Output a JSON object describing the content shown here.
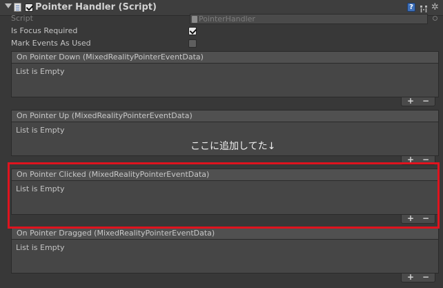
{
  "component": {
    "title": "Pointer Handler (Script)",
    "enabled": true
  },
  "properties": {
    "script_label": "Script",
    "script_value": "PointerHandler",
    "focus_label": "Is Focus Required",
    "focus_checked": true,
    "mark_label": "Mark Events As Used",
    "mark_checked": false
  },
  "events": [
    {
      "header": "On Pointer Down (MixedRealityPointerEventData)",
      "empty_text": "List is Empty"
    },
    {
      "header": "On Pointer Up (MixedRealityPointerEventData)",
      "empty_text": "List is Empty"
    },
    {
      "header": "On Pointer Clicked (MixedRealityPointerEventData)",
      "empty_text": "List is Empty"
    },
    {
      "header": "On Pointer Dragged (MixedRealityPointerEventData)",
      "empty_text": "List is Empty"
    }
  ],
  "list_buttons": {
    "plus": "+",
    "minus": "−"
  },
  "icons": {
    "help": "?",
    "gear": "✲"
  },
  "annotation": {
    "note": "ここに追加してた↓",
    "highlight_color": "#e0131e"
  }
}
